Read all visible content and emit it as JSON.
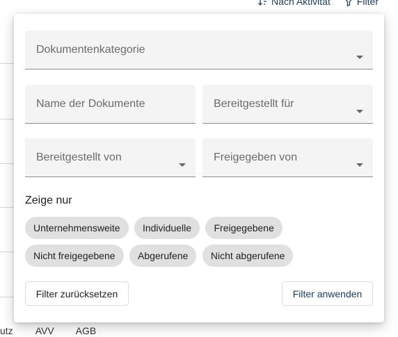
{
  "background": {
    "top_actions": [
      {
        "label": "Nach Aktivität",
        "icon": "sort-icon"
      },
      {
        "label": "Filter",
        "icon": "filter-icon"
      }
    ],
    "bottom_tabs": [
      "utz",
      "AVV",
      "AGB"
    ]
  },
  "filter_panel": {
    "fields": {
      "category": {
        "label": "Dokumentenkategorie"
      },
      "document_name": {
        "label": "Name der Dokumente"
      },
      "provided_for": {
        "label": "Bereitgestellt für"
      },
      "provided_by": {
        "label": "Bereitgestellt von"
      },
      "released_by": {
        "label": "Freigegeben von"
      }
    },
    "show_only_title": "Zeige nur",
    "chips": [
      "Unternehmensweite",
      "Individuelle",
      "Freigegebene",
      "Nicht freigegebene",
      "Abgerufene",
      "Nicht abgerufene"
    ],
    "reset_label": "Filter zurücksetzen",
    "apply_label": "Filter anwenden"
  }
}
